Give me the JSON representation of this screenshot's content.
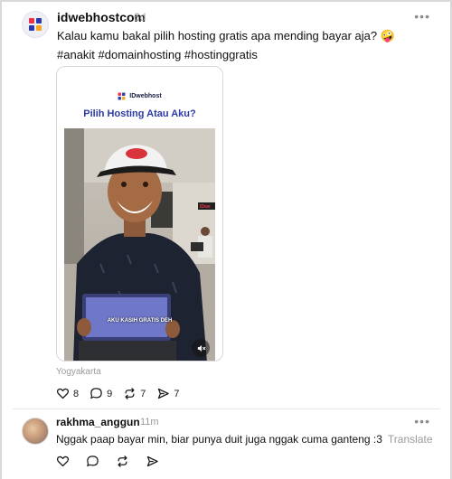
{
  "post": {
    "username": "idwebhostcom",
    "time": "6d",
    "text": "Kalau kamu bakal pilih hosting gratis apa mending bayar aja? 🤪",
    "hashtags": "#anakit #domainhosting #hostinggratis",
    "media": {
      "brand": "IDwebhost",
      "title": "Pilih Hosting Atau Aku?",
      "caption": "AKU KASIH GRATIS DEH",
      "logo_right": "IDwe"
    },
    "location": "Yogyakarta",
    "actions": {
      "likes": "8",
      "comments": "9",
      "reposts": "7",
      "shares": "7"
    },
    "more_label": "•••"
  },
  "comment": {
    "username": "rakhma_anggun",
    "time": "11m",
    "text": "Nggak paap bayar min, biar punya duit juga nggak cuma ganteng :3",
    "translate": "Translate",
    "more_label": "•••"
  },
  "colors": {
    "brand_blue": "#2b3aa8",
    "brand_red": "#e8334a",
    "muted": "#9a9a9a"
  }
}
